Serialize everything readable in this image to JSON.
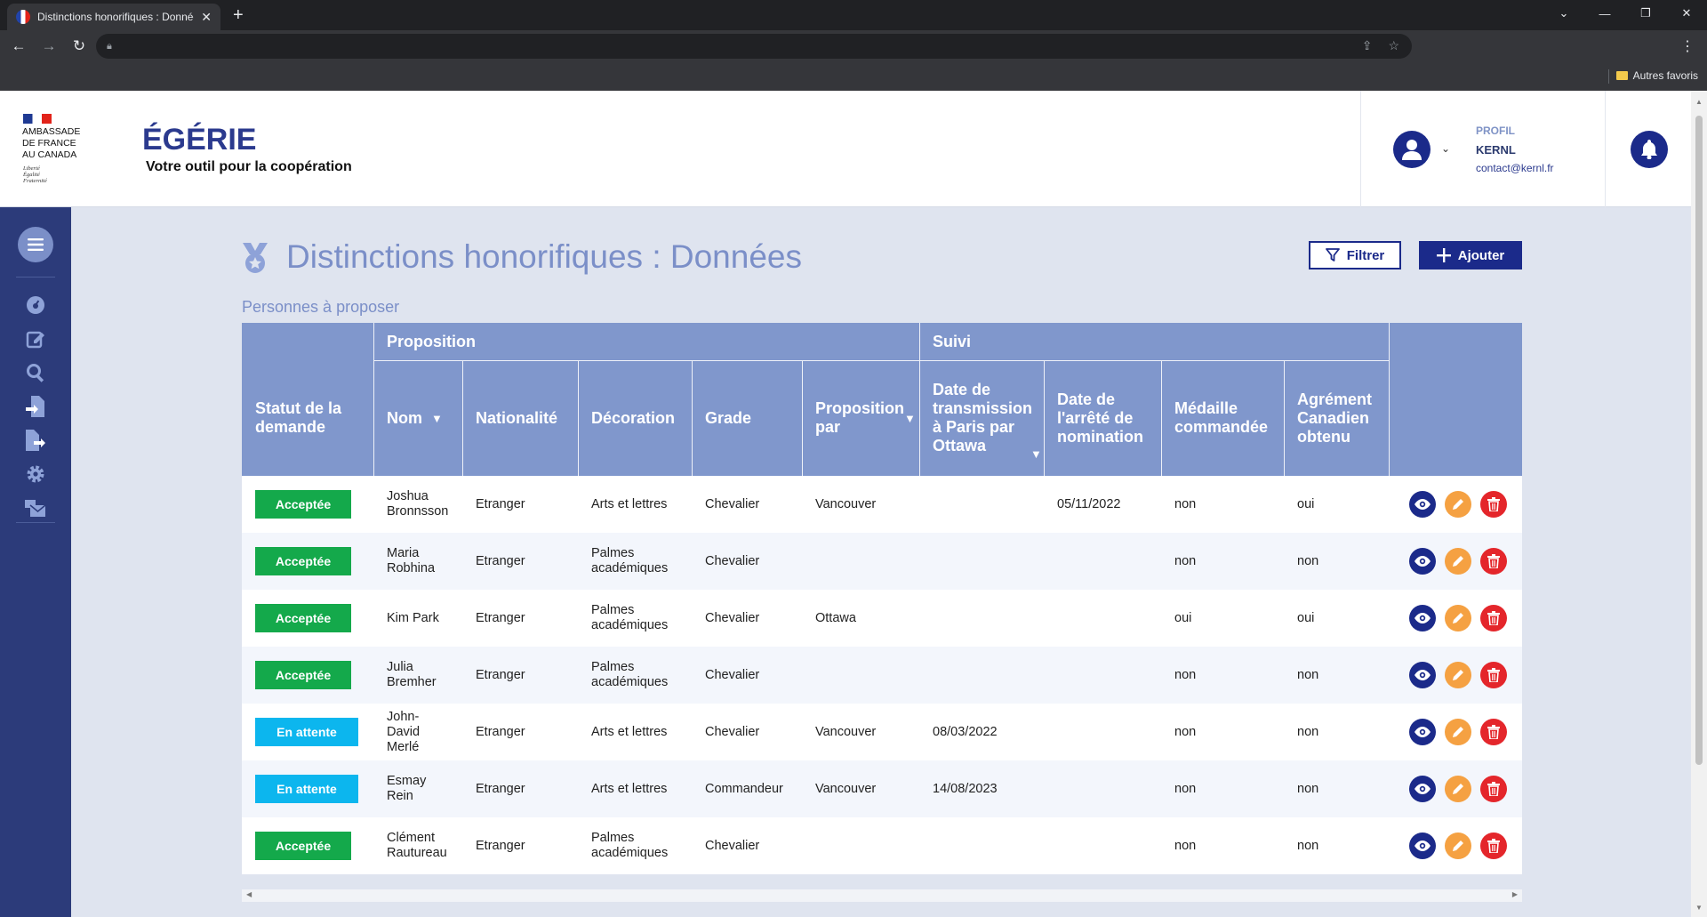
{
  "browser": {
    "tab_title": "Distinctions honorifiques : Données",
    "bookmark_folder": "Autres favoris"
  },
  "header": {
    "embassy_line1": "AMBASSADE",
    "embassy_line2": "DE FRANCE",
    "embassy_line3": "AU CANADA",
    "motto1": "Liberté",
    "motto2": "Égalité",
    "motto3": "Fraternité",
    "app_title": "ÉGÉRIE",
    "app_tagline": "Votre outil pour la coopération",
    "profile_label": "PROFIL",
    "profile_name": "KERNL",
    "profile_email": "contact@kernl.fr"
  },
  "sidebar": {
    "icons": [
      "dashboard-icon",
      "edit-icon",
      "search-icon",
      "file-import-icon",
      "file-export-icon",
      "settings-icon",
      "mail-bulk-icon"
    ]
  },
  "page": {
    "title": "Distinctions honorifiques : Données",
    "filter_label": "Filtrer",
    "add_label": "Ajouter",
    "section_title": "Personnes à proposer"
  },
  "table": {
    "group_proposition": "Proposition",
    "group_suivi": "Suivi",
    "col_statut": "Statut de la demande",
    "col_nom": "Nom",
    "col_nationalite": "Nationalité",
    "col_decoration": "Décoration",
    "col_grade": "Grade",
    "col_proposition_par": "Proposition par",
    "col_date_transmission": "Date de transmission à Paris par Ottawa",
    "col_date_arrete": "Date de l'arrêté de nomination",
    "col_medaille": "Médaille commandée",
    "col_agrement": "Agrément Canadien obtenu",
    "rows": [
      {
        "statut": "Acceptée",
        "nom": "Joshua Bronnsson",
        "nationalite": "Etranger",
        "decoration": "Arts et lettres",
        "grade": "Chevalier",
        "proposition_par": "Vancouver",
        "date_transmission": "",
        "date_arrete": "05/11/2022",
        "medaille": "non",
        "agrement": "oui"
      },
      {
        "statut": "Acceptée",
        "nom": "Maria Robhina",
        "nationalite": "Etranger",
        "decoration": "Palmes académiques",
        "grade": "Chevalier",
        "proposition_par": "",
        "date_transmission": "",
        "date_arrete": "",
        "medaille": "non",
        "agrement": "non"
      },
      {
        "statut": "Acceptée",
        "nom": "Kim Park",
        "nationalite": "Etranger",
        "decoration": "Palmes académiques",
        "grade": "Chevalier",
        "proposition_par": "Ottawa",
        "date_transmission": "",
        "date_arrete": "",
        "medaille": "oui",
        "agrement": "oui"
      },
      {
        "statut": "Acceptée",
        "nom": "Julia Bremher",
        "nationalite": "Etranger",
        "decoration": "Palmes académiques",
        "grade": "Chevalier",
        "proposition_par": "",
        "date_transmission": "",
        "date_arrete": "",
        "medaille": "non",
        "agrement": "non"
      },
      {
        "statut": "En attente",
        "nom": "John-David Merlé",
        "nationalite": "Etranger",
        "decoration": "Arts et lettres",
        "grade": "Chevalier",
        "proposition_par": "Vancouver",
        "date_transmission": "08/03/2022",
        "date_arrete": "",
        "medaille": "non",
        "agrement": "non"
      },
      {
        "statut": "En attente",
        "nom": "Esmay Rein",
        "nationalite": "Etranger",
        "decoration": "Arts et lettres",
        "grade": "Commandeur",
        "proposition_par": "Vancouver",
        "date_transmission": "14/08/2023",
        "date_arrete": "",
        "medaille": "non",
        "agrement": "non"
      },
      {
        "statut": "Acceptée",
        "nom": "Clément Rautureau",
        "nationalite": "Etranger",
        "decoration": "Palmes académiques",
        "grade": "Chevalier",
        "proposition_par": "",
        "date_transmission": "",
        "date_arrete": "",
        "medaille": "non",
        "agrement": "non"
      }
    ]
  },
  "colors": {
    "accepted": "#14a94b",
    "pending": "#0cb6ee",
    "primary": "#1b2a8a",
    "header_blue": "#8097cc",
    "edit": "#f5a142",
    "delete": "#e4262b"
  }
}
